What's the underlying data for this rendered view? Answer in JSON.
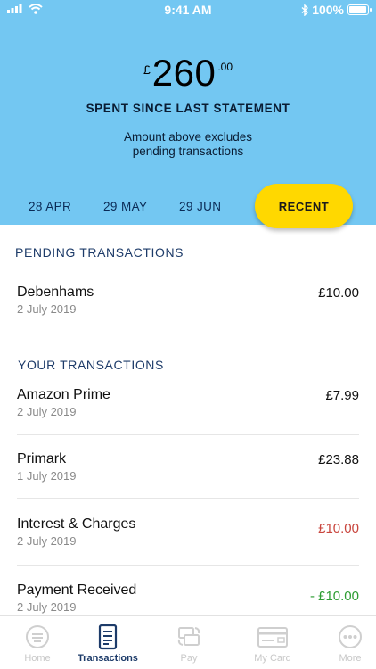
{
  "status_bar": {
    "time": "9:41 AM",
    "battery": "100%",
    "battery_level": 1.0,
    "icons": [
      "signal-icon",
      "wifi-icon",
      "bluetooth-icon",
      "battery-icon"
    ]
  },
  "header": {
    "currency": "£",
    "amount_whole": "260",
    "amount_pence": ".00",
    "spent_label": "SPENT SINCE LAST STATEMENT",
    "note_line1": "Amount above excludes",
    "note_line2": "pending transactions",
    "background_color": "#73c7f2"
  },
  "date_tabs": [
    {
      "label": "28 APR"
    },
    {
      "label": "29 MAY"
    },
    {
      "label": "29 JUN"
    }
  ],
  "recent_button": {
    "label": "RECENT",
    "color": "#ffd800"
  },
  "pending": {
    "title": "PENDING TRANSACTIONS",
    "items": [
      {
        "name": "Debenhams",
        "date": "2 July 2019",
        "amount": "£10.00"
      }
    ]
  },
  "yours": {
    "title": "YOUR TRANSACTIONS",
    "items": [
      {
        "name": "Amazon Prime",
        "date": "2 July 2019",
        "amount": "£7.99"
      },
      {
        "name": "Primark",
        "date": "1 July 2019",
        "amount": "£23.88"
      },
      {
        "name": "Interest & Charges",
        "date": "2 July 2019",
        "amount": "£10.00"
      },
      {
        "name": "Payment Received",
        "date": "2 July 2019",
        "amount": "- £10.00"
      }
    ]
  },
  "colors": {
    "charge": "#c9463e",
    "credit": "#2e9d33",
    "active_tab": "#1d3b69"
  },
  "tab_bar": [
    {
      "label": "Home",
      "icon": "home-icon"
    },
    {
      "label": "Transactions",
      "icon": "transactions-icon"
    },
    {
      "label": "Pay",
      "icon": "pay-icon"
    },
    {
      "label": "My Card",
      "icon": "card-icon"
    },
    {
      "label": "More",
      "icon": "more-icon"
    }
  ]
}
